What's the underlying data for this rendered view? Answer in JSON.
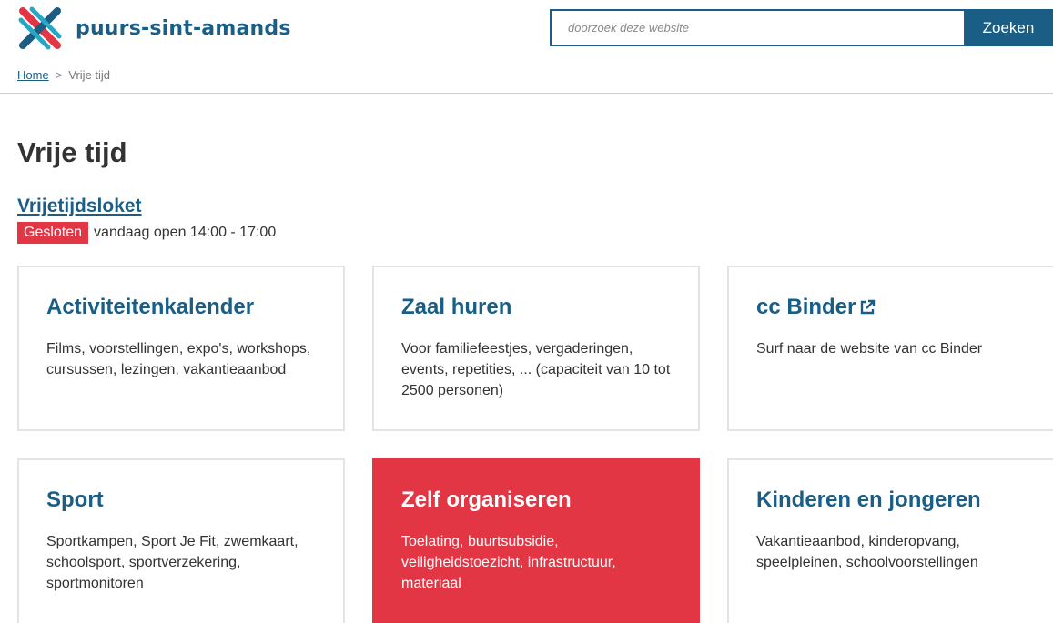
{
  "header": {
    "logo_text": "puurs-sint-amands",
    "search": {
      "placeholder": "doorzoek deze website",
      "button_label": "Zoeken"
    }
  },
  "breadcrumb": {
    "home": "Home",
    "separator": ">",
    "current": "Vrije tijd"
  },
  "page": {
    "title": "Vrije tijd"
  },
  "loket": {
    "link_label": "Vrijetijdsloket",
    "status_badge": "Gesloten",
    "status_text": "vandaag open 14:00 - 17:00"
  },
  "cards": [
    {
      "title": "Activiteitenkalender",
      "description": "Films, voorstellingen, expo's, workshops, cursussen, lezingen, vakantieaanbod"
    },
    {
      "title": "Zaal huren",
      "description": "Voor familiefeestjes, vergaderingen, events, repetities, ... (capaciteit van 10 tot 2500 personen)"
    },
    {
      "title": "cc Binder",
      "description": "Surf naar de website van cc Binder"
    },
    {
      "title": "Sport",
      "description": "Sportkampen, Sport Je Fit, zwemkaart, schoolsport, sportverzekering, sportmonitoren"
    },
    {
      "title": "Zelf organiseren",
      "description": "Toelating, buurtsubsidie, veiligheidstoezicht, infrastructuur, materiaal"
    },
    {
      "title": "Kinderen en jongeren",
      "description": "Vakantieaanbod, kinderopvang, speelpleinen, schoolvoorstellingen"
    }
  ],
  "icons": {
    "logo": "logo-cross-icon",
    "external": "external-link-icon"
  },
  "colors": {
    "brand_blue": "#1b5e85",
    "accent_red": "#e23645",
    "card_border": "#e4e4e4",
    "text": "#333333"
  }
}
